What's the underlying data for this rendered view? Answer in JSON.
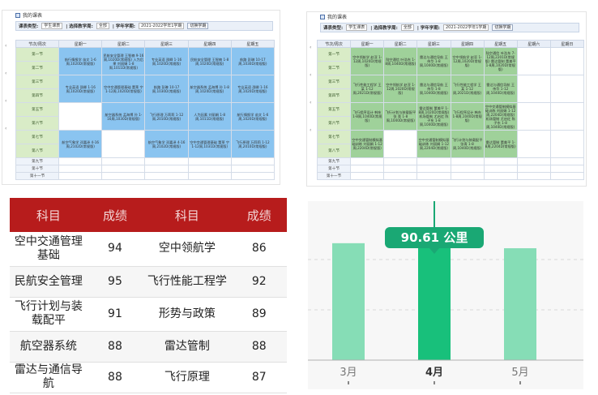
{
  "timetable1": {
    "title": "我的课表",
    "filter": {
      "type_label": "课表类型:",
      "type_value": "学生课表",
      "mode_label": "| 选择教学周:",
      "mode_value": "全部",
      "year_label": "| 学年学期:",
      "year_value": "2021-2022学年1学期",
      "switch_label": "切换学期"
    },
    "headers": [
      "节次/周次",
      "星期一",
      "星期二",
      "星期三",
      "星期四",
      "星期五"
    ],
    "periods": [
      "第一节",
      "第二节",
      "第三节",
      "第四节",
      "第五节",
      "第六节",
      "第七节",
      "第八节",
      "第九节",
      "第十节",
      "第十一节"
    ],
    "blocks": [
      {
        "label": "1-2",
        "cells": [
          "航行情报学 苗文 1-6周,1020D(常规版)",
          "民航安全管理 王智楠 9-16周,1020D(常规版) 入为后果 刘丽娟 1-8周,1011D(常规版)",
          "专业英语 邵卿 1-16周,1020D(常规版)",
          "民航安全管理 王智楠 1-8周,1020D(常规版)",
          "航路 彭琳 10-17周,1030D(常规版)"
        ]
      },
      {
        "label": "3-4",
        "cells": [
          "专业英语 邵卿 1-16周,1020D(常规版)",
          "空中交通管理基础 董莱 宁 1-12周,1020D(常规版)",
          "航路 彭琳 10-17周,1030D(常规版)",
          "航空器系统 孟海博 孙 1-8周,1020D(常规版)",
          "专业英语 邵卿 1-16周,1020D(常规版)"
        ]
      },
      {
        "label": "5-6",
        "cells": [
          "",
          "航空器系统 孟海博 孙 1-16周,1030D(常规版)",
          "飞行原理 万莉莉 1-12周,2010D(常规版)",
          "人为因素 刘丽娟 1-8周,1011D(常规版)",
          "航行情报学 苗文 1-6周,1020D(常规版)"
        ]
      },
      {
        "label": "7-8",
        "cells": [
          "航空气象学 邓嘉泽 4-16周,2102D(常规版)",
          "",
          "航空气象学 邓嘉泽 4-16周,2102D(常规版)",
          "空中交通管理基础 董莱 宁 1-12周,1031D(常规版)",
          "飞行原理 万莉莉 1-12周,2010D(常规版)"
        ]
      }
    ]
  },
  "timetable2": {
    "title": "我的课表",
    "filter": {
      "type_label": "课表类型:",
      "type_value": "学生课表",
      "mode_label": "| 选择教学周:",
      "mode_value": "全部",
      "year_label": "| 学年学期:",
      "year_value": "2021-2022学年1学期",
      "switch_label": "切换学期"
    },
    "headers": [
      "节次/周次",
      "星期一",
      "星期二",
      "星期三",
      "星期四",
      "星期五",
      "星期六",
      "星期日"
    ],
    "periods": [
      "第一节",
      "第二节",
      "第三节",
      "第四节",
      "第五节",
      "第六节",
      "第七节",
      "第八节",
      "第九节",
      "第十节",
      "第十一节"
    ],
    "blocks": [
      {
        "label": "1-2",
        "cells": [
          "空中领航学 赵亚 1-12周,1020D(常规版)",
          "陆空通信 叶浩东 1-8周,1040D(常规版)",
          "雷达与通信导航 王伟华 1-8周,1040D(常规版)",
          "空中领航学 赵亚 1-12周,1020D(常规版)",
          "陆空通信 叶浩东 7-12周,2201D(常规版) 雷达管制 董美平 1-8周,1020D(常规版)",
          "",
          ""
        ]
      },
      {
        "label": "3-4",
        "cells": [
          "飞行性能工程学 王某 1-12周,2021D(常规版)",
          "空中领航学 赵亚 1-12周,1020D(常规版)",
          "雷达与通信导航 王伟华 1-8周,1040D(常规版)",
          "飞行性能工程学 王某 1-12周,2021D(常规版)",
          "雷达与通信导航 王伟华 1-12周,1040D(常规版)",
          "",
          ""
        ]
      },
      {
        "label": "5-6",
        "cells": [
          "飞行程序设计 韩东 1-8周,1040D(常规版)",
          "飞行计划与装载配平 张 青 1-8周,1040D(常规版)",
          "雷达管制 董美平 1-8周,1020D(常规版) 机场管制 尤启红 陈子东 1-8周,1040D(常规版)",
          "飞行程序设计 韩东 1-8周,1040D(常规版)",
          "空中交通管制模拟基础训练 刘丽娟 1-12周,2204D(常规版) 机场管制 尤启红 陈子东 1-8周,1040D(常规版)",
          "",
          ""
        ]
      },
      {
        "label": "7-8",
        "cells": [
          "空中交通管制模拟基础训练 刘丽娟 1-12周,2204D(常规版)",
          "",
          "空中交通管制模拟基础训练 刘丽娟 1-12周,2204D(常规版)",
          "飞行计划与装载配平 张青 1-8周,1040D(常规版)",
          "雷达管制 董美平 1-8周,2204D(常规版)",
          "",
          ""
        ]
      }
    ]
  },
  "grades": {
    "headers": [
      "科目",
      "成绩",
      "科目",
      "成绩"
    ],
    "rows": [
      [
        "空中交通管理基础",
        "94",
        "空中领航学",
        "86"
      ],
      [
        "民航安全管理",
        "95",
        "飞行性能工程学",
        "92"
      ],
      [
        "飞行计划与装载配平",
        "91",
        "形势与政策",
        "89"
      ],
      [
        "航空器系统",
        "88",
        "雷达管制",
        "88"
      ],
      [
        "雷达与通信导航",
        "88",
        "飞行原理",
        "87"
      ]
    ]
  },
  "colors": {
    "timetable_course_blue": "#8ac4f0",
    "timetable_course_green": "#9fd19a",
    "period_green": "#d9ecc7",
    "grade_header_red": "#b71c1c",
    "bar_light": "#86ddb6",
    "bar_selected": "#18c07b",
    "tooltip": "#1aa874"
  },
  "chart_data": {
    "type": "bar",
    "categories": [
      "3月",
      "4月",
      "5月"
    ],
    "values": [
      93,
      90.61,
      89
    ],
    "selected_index": 1,
    "tooltip_text": "90.61 公里",
    "ylim": [
      0,
      120
    ],
    "grid": true,
    "title": "",
    "xlabel": "",
    "ylabel": ""
  }
}
